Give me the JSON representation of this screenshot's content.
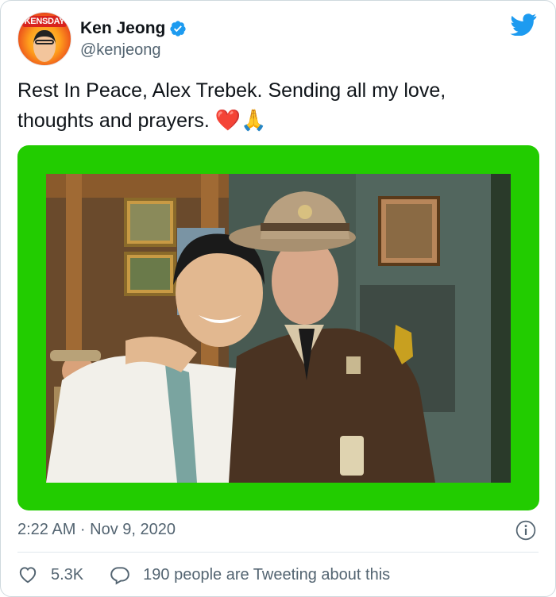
{
  "author": {
    "display_name": "Ken Jeong",
    "handle": "@kenjeong",
    "avatar_banner_text": "KENSDAY",
    "verified": true
  },
  "tweet": {
    "text": "Rest In Peace, Alex Trebek. Sending all my love, thoughts and prayers.",
    "emojis": [
      "❤️",
      "🙏"
    ]
  },
  "media": {
    "frame_color": "#22cc00",
    "alt": "photo"
  },
  "meta": {
    "timestamp": "2:22 AM · Nov 9, 2020"
  },
  "actions": {
    "like_count": "5.3K",
    "reply_text": "190 people are Tweeting about this"
  },
  "colors": {
    "twitter_blue": "#1d9bf0",
    "secondary_text": "#536471",
    "heart_red": "#dd2e44"
  },
  "icons": [
    "verified-icon",
    "twitter-bird-icon",
    "info-icon",
    "heart-icon",
    "reply-icon"
  ]
}
